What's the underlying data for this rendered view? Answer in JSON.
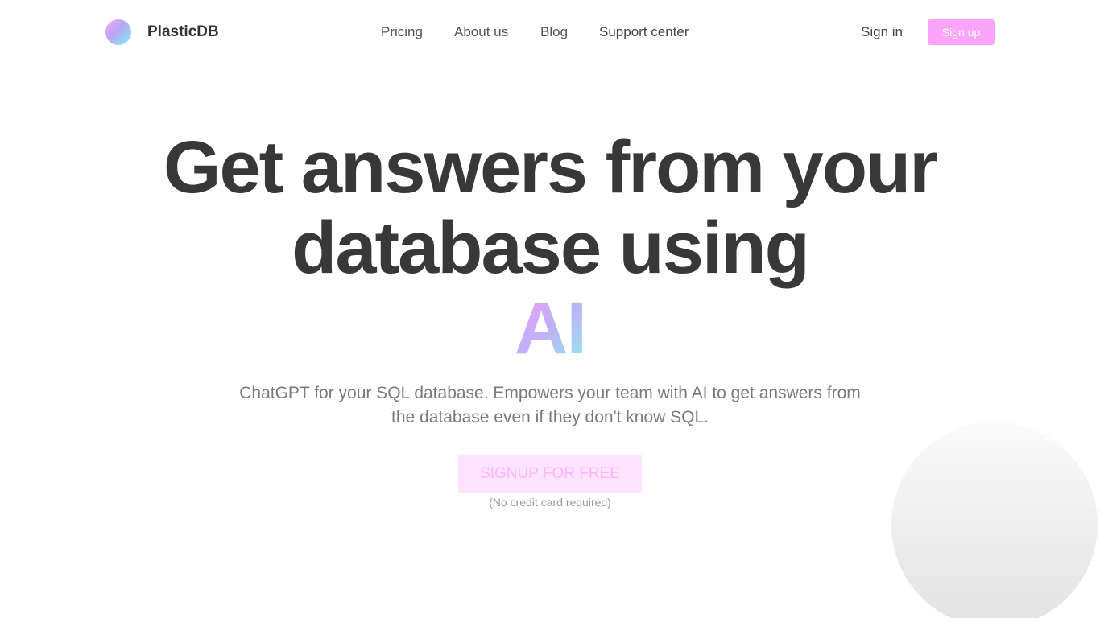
{
  "header": {
    "brand": "PlasticDB",
    "nav": {
      "pricing": "Pricing",
      "about": "About us",
      "blog": "Blog",
      "support": "Support center"
    },
    "signin": "Sign in",
    "signup": "Sign up"
  },
  "hero": {
    "title_line1": "Get answers from your",
    "title_line2": "database using",
    "title_highlight": "AI",
    "subtitle": "ChatGPT for your SQL database. Empowers your team with AI to get answers from the database even if they don't know SQL.",
    "cta": "SIGNUP FOR FREE",
    "cta_note": "(No credit card required)"
  },
  "colors": {
    "accent": "#fca3fb",
    "cta_background": "#fde3fd",
    "heading": "#383838"
  }
}
